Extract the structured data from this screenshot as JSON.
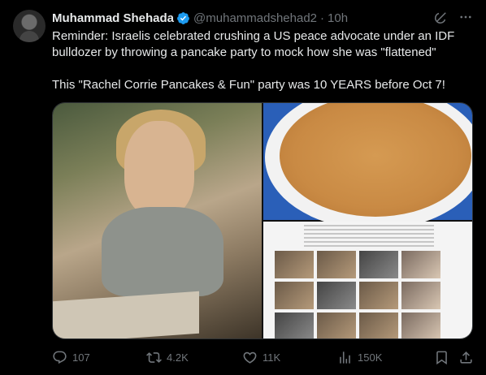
{
  "author": {
    "name": "Muhammad Shehada",
    "handle": "@muhammadshehad2",
    "time": "10h",
    "verified_color": "#1d9bf0"
  },
  "tweet": {
    "line1": "Reminder: Israelis celebrated crushing a US peace advocate under an IDF bulldozer by throwing a pancake party to mock how she was \"flattened\"",
    "line2": "This \"Rachel Corrie Pancakes & Fun\" party was 10 YEARS before Oct 7!"
  },
  "actions": {
    "replies": "107",
    "reposts": "4.2K",
    "likes": "11K",
    "views": "150K"
  },
  "icons": {
    "grok": "grok-icon",
    "more": "more-icon",
    "reply": "reply-icon",
    "repost": "repost-icon",
    "like": "like-icon",
    "views": "views-icon",
    "bookmark": "bookmark-icon",
    "share": "share-icon"
  },
  "colors": {
    "background": "#000000",
    "text": "#e7e9ea",
    "muted": "#71767b",
    "border": "#2f3336"
  }
}
